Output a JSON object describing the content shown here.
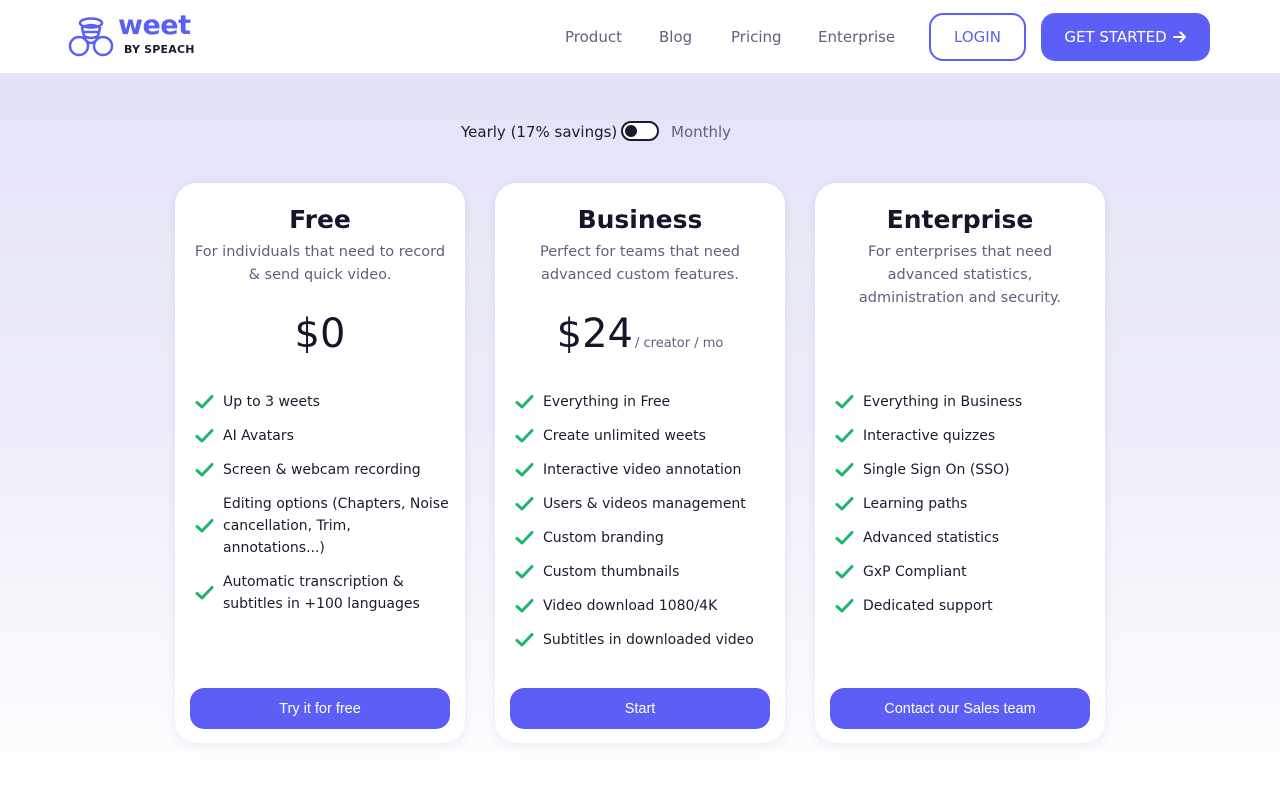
{
  "header": {
    "logo_word": "weet",
    "logo_sub": "BY SPEACH",
    "nav": [
      "Product",
      "Blog",
      "Pricing",
      "Enterprise"
    ],
    "login_label": "LOGIN",
    "get_started_label": "GET STARTED",
    "get_started_icon": "arrow-right-icon"
  },
  "billing_toggle": {
    "yearly_label": "Yearly (17% savings)",
    "monthly_label": "Monthly",
    "selected": "yearly"
  },
  "colors": {
    "accent": "#5b5ff5",
    "check": "#1fb56b",
    "text_dark": "#15152b",
    "text_muted": "#5e6180"
  },
  "plans": [
    {
      "title": "Free",
      "description": "For individuals that need to record & send quick video.",
      "price": "$0",
      "price_unit": "",
      "features": [
        "Up to 3 weets",
        "AI Avatars",
        "Screen & webcam recording",
        "Editing options (Chapters, Noise cancellation, Trim, annotations...)",
        "Automatic transcription & subtitles in +100 languages"
      ],
      "cta": "Try it for free"
    },
    {
      "title": "Business",
      "description": "Perfect for teams that need advanced custom features.",
      "price": "$24",
      "price_unit": "/ creator / mo",
      "features": [
        "Everything in Free",
        "Create unlimited weets",
        "Interactive video annotation",
        "Users & videos management",
        "Custom branding",
        "Custom thumbnails",
        "Video download 1080/4K",
        "Subtitles in downloaded video"
      ],
      "cta": "Start"
    },
    {
      "title": "Enterprise",
      "description": "For enterprises that need advanced statistics, administration and security.",
      "price": "",
      "price_unit": "",
      "features": [
        "Everything in Business",
        "Interactive quizzes",
        "Single Sign On (SSO)",
        "Learning paths",
        "Advanced statistics",
        "GxP Compliant",
        "Dedicated support"
      ],
      "cta": "Contact our Sales team"
    }
  ]
}
